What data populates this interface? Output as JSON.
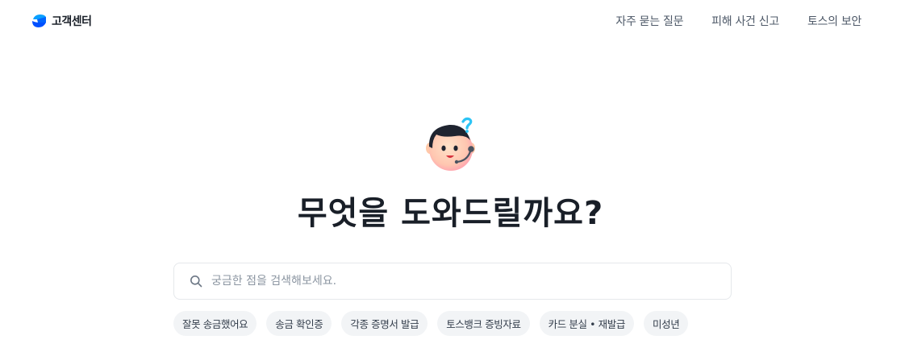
{
  "header": {
    "brand": "고객센터",
    "nav": [
      {
        "label": "자주 묻는 질문"
      },
      {
        "label": "피해 사건 신고"
      },
      {
        "label": "토스의 보안"
      }
    ]
  },
  "hero": {
    "title": "무엇을 도와드릴까요?"
  },
  "search": {
    "placeholder": "궁금한 점을 검색해보세요."
  },
  "quick_chips": [
    {
      "label": "잘못 송금했어요"
    },
    {
      "label": "송금 확인증"
    },
    {
      "label": "각종 증명서 발급"
    },
    {
      "label": "토스뱅크 증빙자료"
    },
    {
      "label": "카드 분실 • 재발급"
    },
    {
      "label": "미성년"
    }
  ],
  "colors": {
    "brand_blue": "#0064ff",
    "text_primary": "#191f28",
    "text_secondary": "#4e5968",
    "chip_bg": "#f2f4f6",
    "border": "#e5e8eb"
  },
  "icons": {
    "logo": "toss-logo-icon",
    "mascot": "support-agent-mascot-icon",
    "search": "search-icon"
  }
}
